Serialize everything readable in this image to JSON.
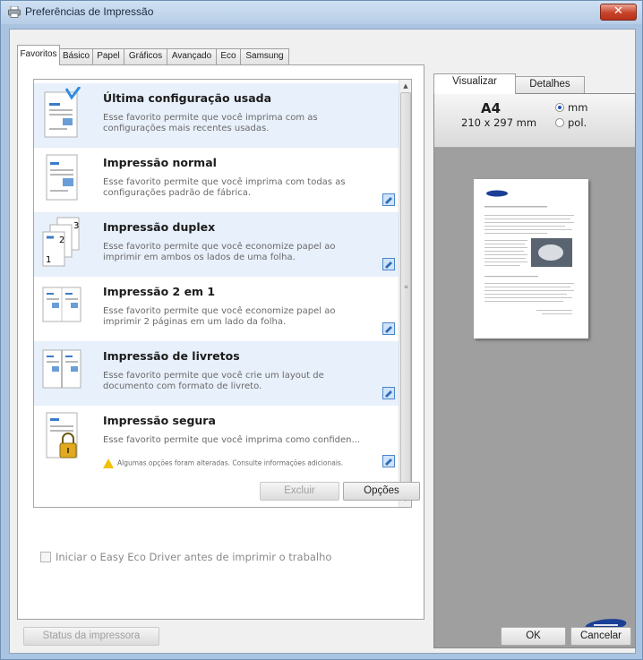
{
  "window": {
    "title": "Preferências de Impressão",
    "close_glyph": "✕"
  },
  "tabs": [
    {
      "label": "Favoritos",
      "active": true
    },
    {
      "label": "Básico"
    },
    {
      "label": "Papel"
    },
    {
      "label": "Gráficos"
    },
    {
      "label": "Avançado"
    },
    {
      "label": "Eco"
    },
    {
      "label": "Samsung"
    }
  ],
  "favorites": [
    {
      "title": "Última configuração usada",
      "desc": "Esse favorito permite que você imprima com as configurações mais recentes usadas.",
      "icon": "last-config-thumb"
    },
    {
      "title": "Impressão normal",
      "desc": "Esse favorito permite que você imprima com todas as configurações padrão de fábrica.",
      "icon": "normal-print-thumb"
    },
    {
      "title": "Impressão duplex",
      "desc": "Esse favorito permite que você economize papel ao imprimir em ambos os lados de uma folha.",
      "icon": "duplex-print-thumb"
    },
    {
      "title": "Impressão 2 em 1",
      "desc": "Esse favorito permite que você economize papel ao imprimir 2 páginas em um lado da folha.",
      "icon": "two-in-one-thumb"
    },
    {
      "title": "Impressão de livretos",
      "desc": "Esse favorito permite que você crie um layout de documento com formato de livreto.",
      "icon": "booklet-thumb"
    },
    {
      "title": "Impressão segura",
      "desc": "Esse favorito permite que você imprima como confiden...",
      "warning": "Algumas opções foram alteradas. Consulte informações adicionais.",
      "icon": "secure-print-thumb"
    }
  ],
  "buttons": {
    "delete": "Excluir",
    "options": "Opções",
    "printer_status": "Status da impressora",
    "ok": "OK",
    "cancel": "Cancelar"
  },
  "eco_checkbox": {
    "label": "Iniciar o Easy Eco Driver antes de imprimir o trabalho",
    "checked": false
  },
  "preview": {
    "tabs": [
      {
        "label": "Visualizar",
        "active": true
      },
      {
        "label": "Detalhes"
      }
    ],
    "paper_name": "A4",
    "paper_dims": "210 x 297 mm",
    "units": [
      {
        "label": "mm",
        "selected": true
      },
      {
        "label": "pol."
      }
    ]
  },
  "colors": {
    "title_bar": "#b7cde7",
    "close_button": "#c8432a",
    "highlight_row": "#e8f0fb",
    "preview_bg": "#9f9f9f",
    "brand_blue": "#1b3f97"
  }
}
